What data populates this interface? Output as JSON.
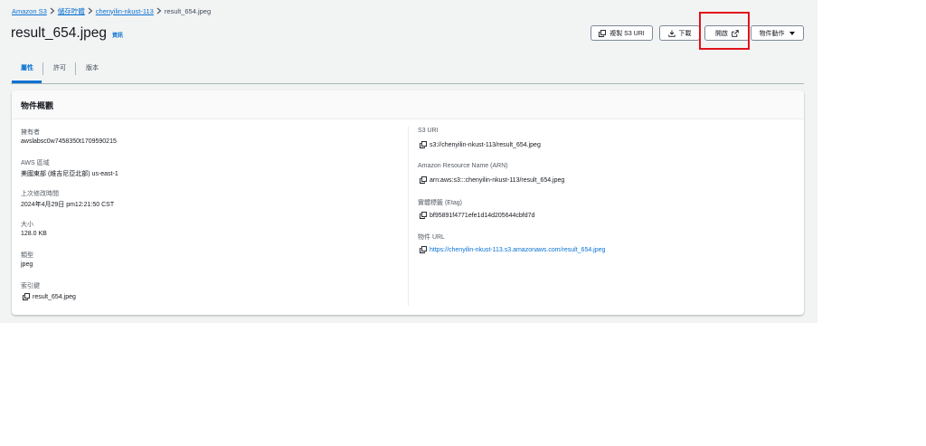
{
  "breadcrumb": {
    "items": [
      {
        "label": "Amazon S3",
        "link": true
      },
      {
        "label": "儲存貯體",
        "link": true
      },
      {
        "label": "chenyilin-nkust-113",
        "link": true
      },
      {
        "label": "result_654.jpeg",
        "link": false
      }
    ]
  },
  "header": {
    "title": "result_654.jpeg",
    "info": "資訊"
  },
  "actions": {
    "copy_uri": "複製 S3 URI",
    "download": "下載",
    "open": "開啟",
    "object_actions": "物件動作"
  },
  "tabs": [
    {
      "label": "屬性",
      "active": true
    },
    {
      "label": "許可",
      "active": false
    },
    {
      "label": "版本",
      "active": false
    }
  ],
  "panel": {
    "title": "物件概觀",
    "left": [
      {
        "label": "擁有者",
        "value": "awslabsc0w7458350t1709590215"
      },
      {
        "label": "AWS 區域",
        "value": "美國東部 (維吉尼亞北部) us-east-1"
      },
      {
        "label": "上次修改時間",
        "value": "2024年4月29日 pm12:21:50 CST"
      },
      {
        "label": "大小",
        "value": "128.0 KB"
      },
      {
        "label": "類型",
        "value": "jpeg"
      },
      {
        "label": "索引鍵",
        "value": "result_654.jpeg"
      }
    ],
    "right": [
      {
        "label": "S3 URI",
        "value": "s3://chenyilin-nkust-113/result_654.jpeg"
      },
      {
        "label": "Amazon Resource Name (ARN)",
        "value": "arn:aws:s3:::chenyilin-nkust-113/result_654.jpeg"
      },
      {
        "label": "實體標籤 (Etag)",
        "value": "bf95891f4771efe1d14d205644cbfd7d"
      },
      {
        "label": "物件 URL",
        "value": "https://chenyilin-nkust-113.s3.amazonaws.com/result_654.jpeg"
      }
    ]
  },
  "colors": {
    "link": "#0972d3",
    "highlight": "#e1121b",
    "background": "#f2f3f3"
  }
}
